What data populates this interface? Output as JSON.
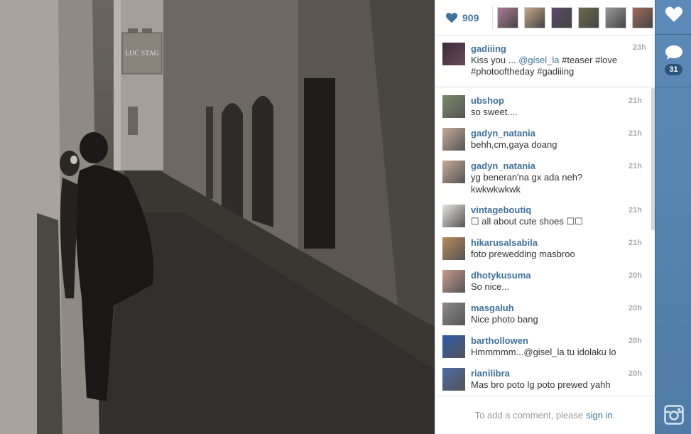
{
  "likes": {
    "count": "909",
    "likers": [
      {
        "color": "#b07a9a"
      },
      {
        "color": "#c9a68a"
      },
      {
        "color": "#5a4a6a"
      },
      {
        "color": "#6a6a4a"
      },
      {
        "color": "#9a9a9a"
      },
      {
        "color": "#a06a5a"
      }
    ]
  },
  "caption": {
    "username": "gadiiing",
    "time": "23h",
    "text_prefix": "Kiss you ... ",
    "mention": "@gisel_la",
    "text_suffix": " #teaser #love",
    "text_line2": "#photooftheday #gadiiing",
    "avatar_color": "#3a2a3a"
  },
  "comments": [
    {
      "username": "ubshop",
      "time": "21h",
      "text": "so sweet....",
      "avatar_color": "#7a8a6a"
    },
    {
      "username": "gadyn_natania",
      "time": "21h",
      "text": "behh,cm,gaya doang",
      "avatar_color": "#c8a896"
    },
    {
      "username": "gadyn_natania",
      "time": "21h",
      "text": "yg beneran'na gx ada neh?",
      "text2": "kwkwkwkwk",
      "avatar_color": "#c8a896"
    },
    {
      "username": "vintageboutiq",
      "time": "21h",
      "text": "☐ all about cute shoes ☐☐",
      "avatar_color": "#e8e4e0"
    },
    {
      "username": "hikarusalsabila",
      "time": "21h",
      "text": "foto prewedding masbroo",
      "avatar_color": "#b88a5a"
    },
    {
      "username": "dhotykusuma",
      "time": "20h",
      "text": "So nice...",
      "avatar_color": "#c89a8a"
    },
    {
      "username": "masgaluh",
      "time": "20h",
      "text": "Nice photo bang",
      "avatar_color": "#8a8a8a"
    },
    {
      "username": "barthollowen",
      "time": "20h",
      "text": "Hmmmmm...@gisel_la tu idolaku lo",
      "avatar_color": "#2a5aa8"
    },
    {
      "username": "rianilibra",
      "time": "20h",
      "text": "Mas bro poto lg poto prewed yahh",
      "avatar_color": "#4a6aa8"
    }
  ],
  "add_comment": {
    "prefix": "To add a comment, please",
    "link": "sign in",
    "suffix": "."
  },
  "rail": {
    "comment_count": "31"
  },
  "photo_sign": "LOC STAG"
}
